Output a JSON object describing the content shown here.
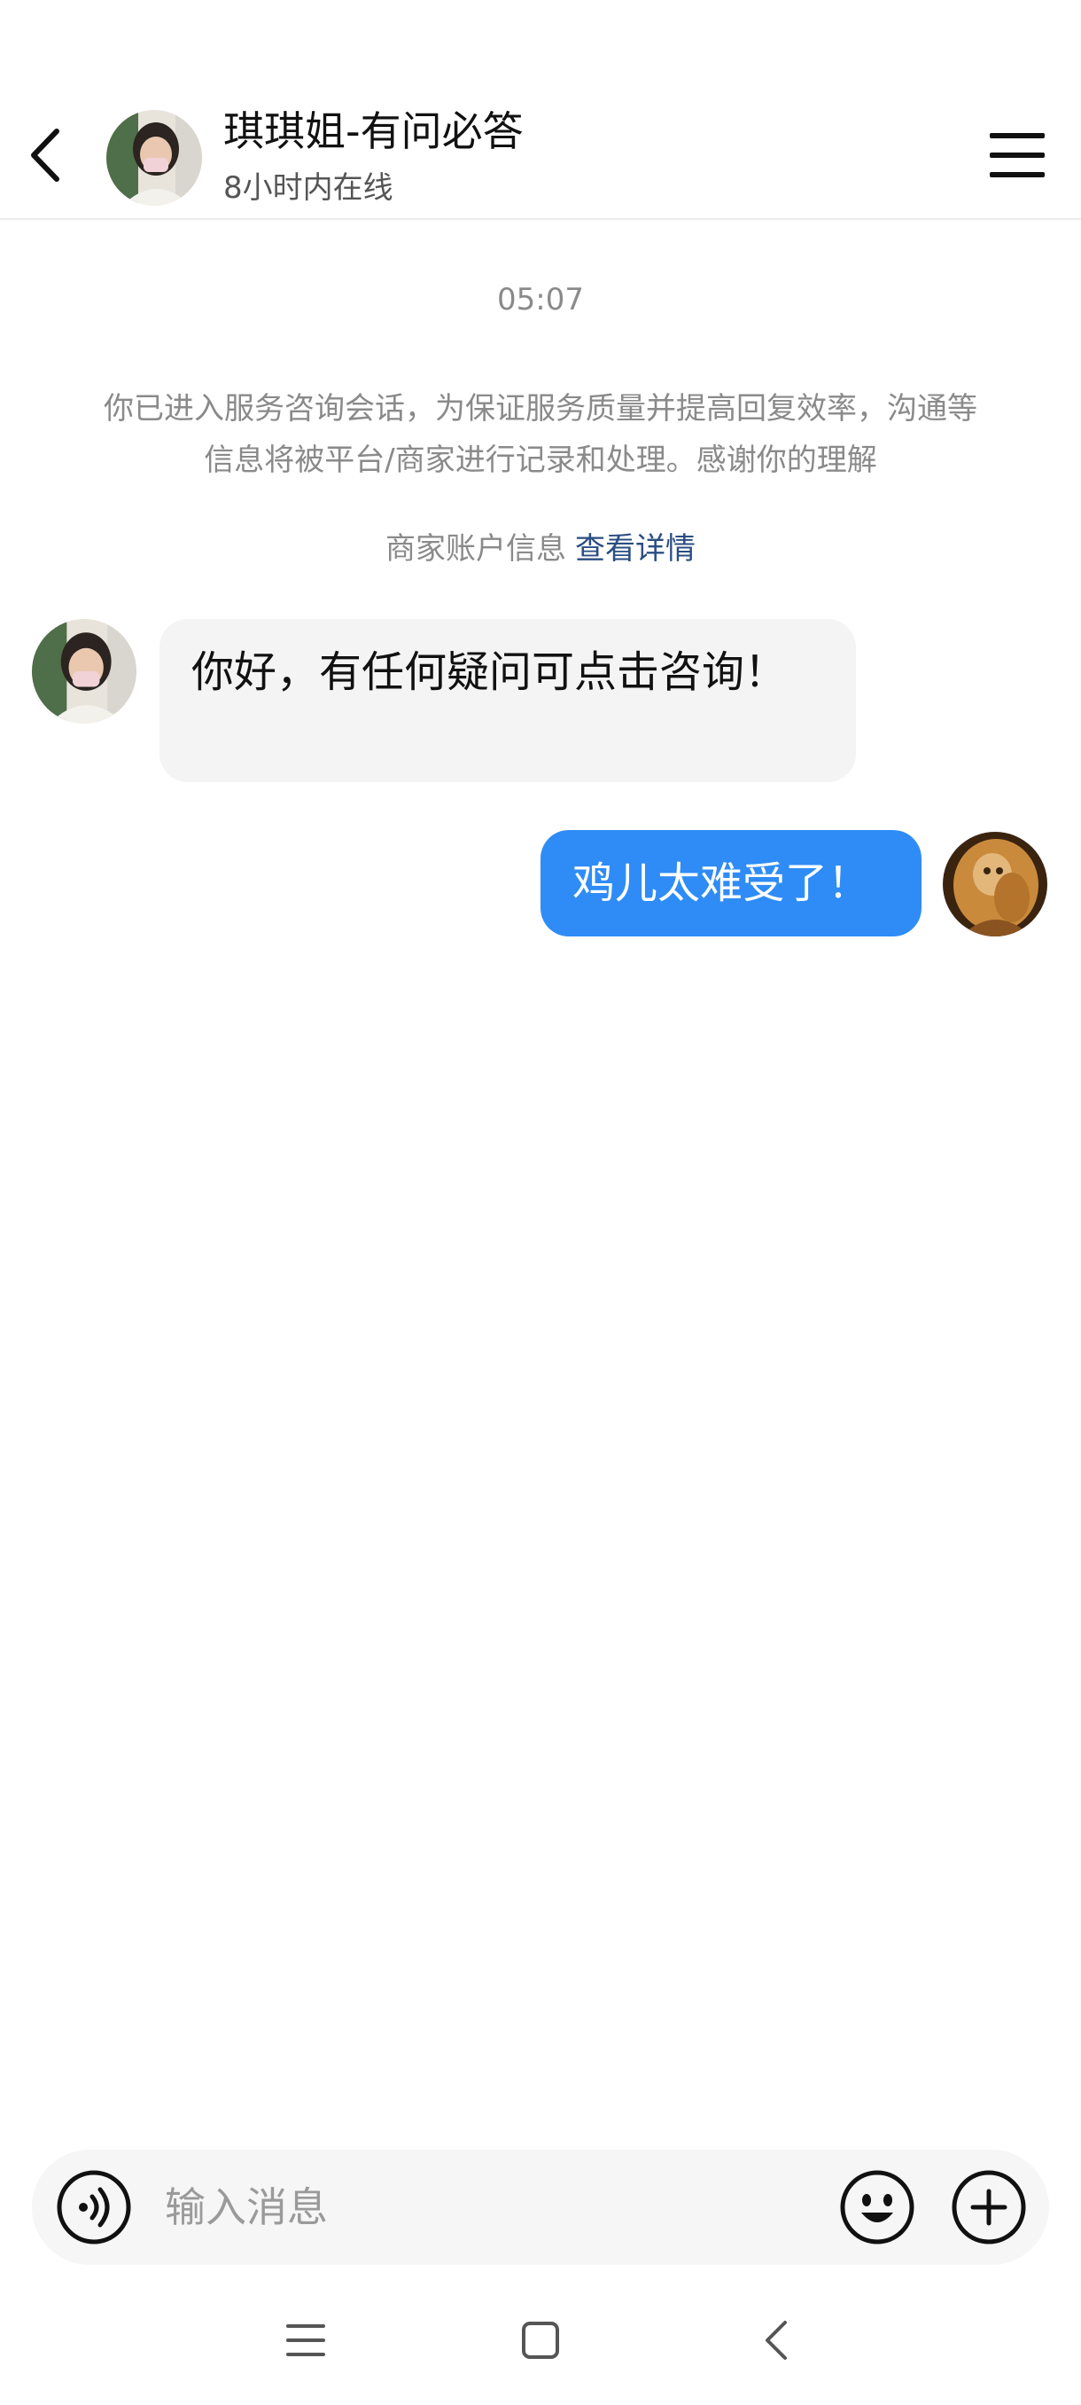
{
  "header": {
    "title": "琪琪姐-有问必答",
    "status": "8小时内在线",
    "back_icon": "chevron-left-icon",
    "menu_icon": "hamburger-menu-icon"
  },
  "chat": {
    "timestamp": "05:07",
    "notice": "你已进入服务咨询会话，为保证服务质量并提高回复效率，沟通等信息将被平台/商家进行记录和处理。感谢你的理解",
    "merchant_info_label": "商家账户信息",
    "merchant_info_link": "查看详情",
    "messages": [
      {
        "from": "merchant",
        "text": "你好，有任何疑问可点击咨询！"
      },
      {
        "from": "user",
        "text": "鸡儿太难受了！"
      }
    ]
  },
  "input_bar": {
    "placeholder": "输入消息",
    "voice_icon": "voice-icon",
    "emoji_icon": "emoji-icon",
    "plus_icon": "plus-icon"
  },
  "system_nav": {
    "recents_icon": "recents-icon",
    "home_icon": "home-icon",
    "back_icon": "back-icon"
  },
  "colors": {
    "user_bubble": "#2f8cf6",
    "merchant_bubble": "#f4f4f4",
    "link": "#2b4d82",
    "muted_text": "#8a8a8a"
  }
}
